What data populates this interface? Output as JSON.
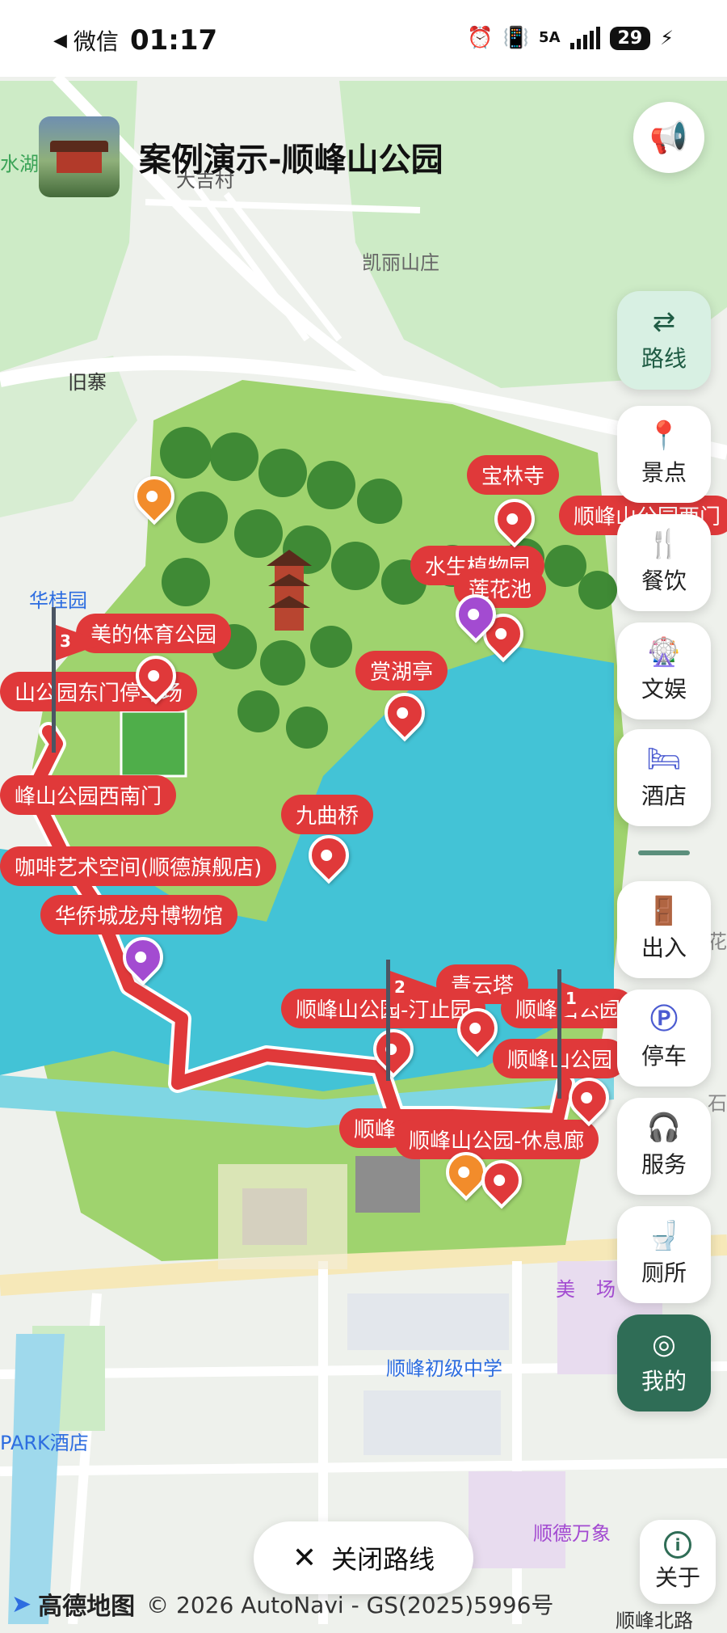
{
  "status_bar": {
    "back_icon": "◀",
    "app": "微信",
    "time": "01:17",
    "network": "5A",
    "battery": "29"
  },
  "header": {
    "title": "案例演示-顺峰山公园",
    "megaphone_icon": "megaphone-icon"
  },
  "side_nav": {
    "route": "路线",
    "scenic": "景点",
    "dining": "餐饮",
    "entertainment": "文娱",
    "hotel": "酒店",
    "entrance": "出入",
    "parking": "停车",
    "service": "服务",
    "toilet": "厕所",
    "mine": "我的"
  },
  "map": {
    "area_labels": {
      "shui_hu": "水湖",
      "da_ji_cun": "大吉村",
      "kai_li": "凯丽山庄",
      "jiu_zhai": "旧寨",
      "hua_gui_yuan": "华桂园",
      "school": "顺峰初级中学",
      "hotel": "PARK酒店",
      "mall": "顺德万象",
      "mall2": "美",
      "mall3": "场",
      "road": "顺峰北路",
      "flower": "花",
      "stone": "石"
    },
    "pois": {
      "baolin": "宝林寺",
      "west_gate": "顺峰山公园西门",
      "aquatic": "水生植物园",
      "lotus": "莲花池",
      "midea": "美的体育公园",
      "east_parking": "山公园东门停车场",
      "shanghu": "赏湖亭",
      "southwest_gate": "峰山公园西南门",
      "jiuqu": "九曲桥",
      "cafe": "咖啡艺术空间(顺德旗舰店)",
      "dragonboat": "华侨城龙舟博物馆",
      "qingyun": "青云塔",
      "tingzhi": "顺峰山公园-汀止园",
      "other1": "顺峰山公园",
      "other2": "顺峰山公园",
      "rest": "顺峰山公园-休息廊",
      "shunfeng": "顺峰"
    },
    "flags": {
      "one": "1",
      "two": "2",
      "three": "3"
    }
  },
  "close_route": "关闭路线",
  "about": "关于",
  "footer": {
    "brand": "高德地图",
    "copyright": "© 2026 AutoNavi - GS(2025)5996号"
  },
  "colors": {
    "route": "#e0393a",
    "accent_green": "#2f6d56",
    "lake": "#43c3d6",
    "park": "#7cc24a"
  }
}
